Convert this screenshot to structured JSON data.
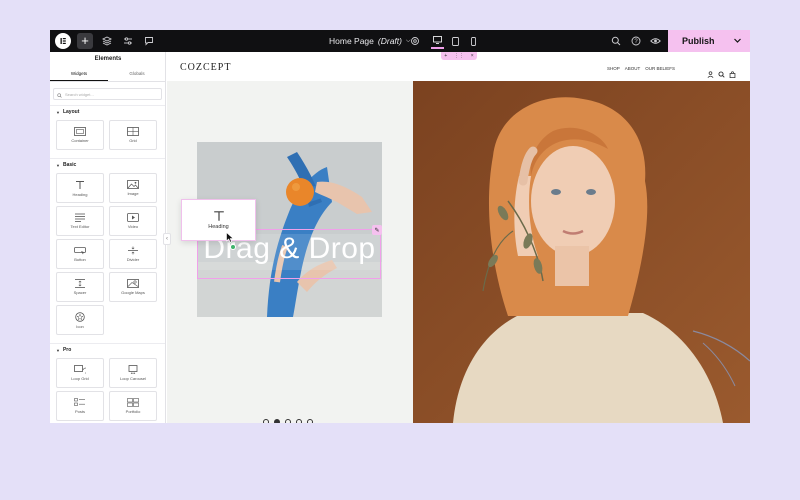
{
  "topbar": {
    "page_title": "Home Page",
    "page_status": "(Draft)",
    "publish_label": "Publish"
  },
  "panel": {
    "title": "Elements",
    "tabs": [
      "Widgets",
      "Globals"
    ],
    "search_placeholder": "Search widget...",
    "categories": {
      "layout": {
        "label": "Layout",
        "widgets": [
          "Container",
          "Grid"
        ]
      },
      "basic": {
        "label": "Basic",
        "widgets": [
          "Heading",
          "Image",
          "Text Editor",
          "Video",
          "Button",
          "Divider",
          "Spacer",
          "Google Maps",
          "Icon"
        ]
      },
      "pro": {
        "label": "Pro",
        "widgets": [
          "Loop Grid",
          "Loop Carousel",
          "Posts",
          "Portfolio"
        ]
      }
    }
  },
  "site": {
    "brand": "COZCEPT",
    "nav": [
      "SHOP",
      "ABOUT",
      "OUR BELIEFS"
    ],
    "headline": "Drag & Drop",
    "drag_widget_label": "Heading",
    "slider_dots": 5,
    "active_dot": 2
  },
  "colors": {
    "background": "#e4e0f8",
    "topbar": "#101012",
    "accent": "#f5c1ef",
    "selection": "#f0a0ea",
    "photo_bg": "#8a4a22",
    "blue": "#3a7fc4"
  }
}
